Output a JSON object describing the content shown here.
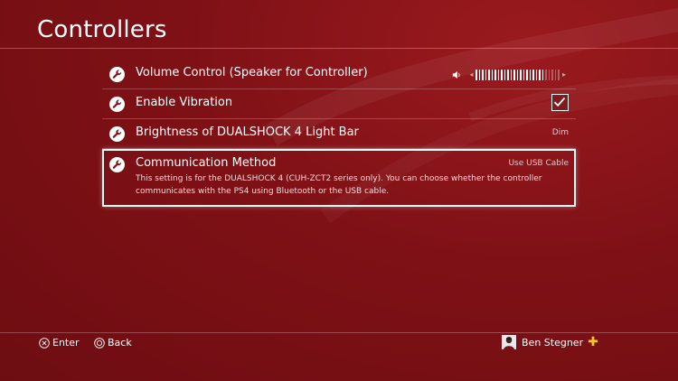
{
  "header": {
    "title": "Controllers"
  },
  "settings": {
    "volume": {
      "label": "Volume Control (Speaker for Controller)",
      "level_filled": 22,
      "level_total": 27
    },
    "vibration": {
      "label": "Enable Vibration",
      "checked": true
    },
    "lightbar": {
      "label": "Brightness of DUALSHOCK 4 Light Bar",
      "value": "Dim"
    },
    "comm": {
      "label": "Communication Method",
      "value": "Use USB Cable",
      "description": "This setting is for the DUALSHOCK 4 (CUH-ZCT2 series only). You can choose whether the controller communicates with the PS4 using Bluetooth or the USB cable."
    }
  },
  "footer": {
    "enter_label": "Enter",
    "back_label": "Back",
    "user_name": "Ben Stegner"
  },
  "colors": {
    "background": "#7f1116",
    "plus_badge": "#f7c52b"
  },
  "icons": [
    "wrench-icon",
    "speaker-icon",
    "checkmark-icon",
    "cross-button-icon",
    "circle-button-icon",
    "avatar",
    "plus-icon"
  ]
}
